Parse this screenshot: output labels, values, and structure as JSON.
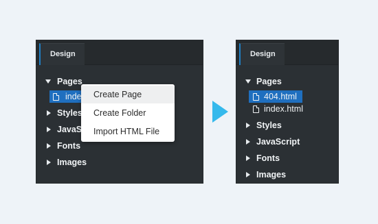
{
  "before": {
    "tab_label": "Design",
    "tree": {
      "pages": "Pages",
      "file": "index.html",
      "styles": "Styles",
      "javascript": "JavaScript",
      "fonts": "Fonts",
      "images": "Images"
    },
    "context_menu": {
      "items": [
        "Create Page",
        "Create Folder",
        "Import HTML File"
      ]
    }
  },
  "after": {
    "tab_label": "Design",
    "tree": {
      "pages": "Pages",
      "files": [
        "404.html",
        "index.html"
      ],
      "styles": "Styles",
      "javascript": "JavaScript",
      "fonts": "Fonts",
      "images": "Images"
    }
  },
  "colors": {
    "panel_bg": "#2b3034",
    "selection": "#1f6fbf",
    "tab_accent": "#1f7fc5",
    "arrow": "#35b9ec",
    "page_bg": "#eef3f8"
  }
}
